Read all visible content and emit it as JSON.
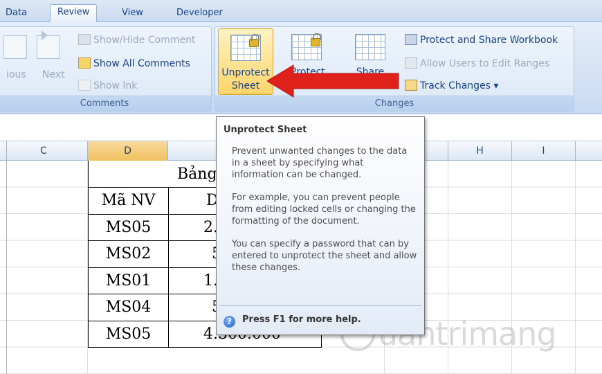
{
  "ribbon": {
    "tabs": [
      "Data",
      "Review",
      "View",
      "Developer"
    ],
    "active_tab": "Review",
    "comments_group": {
      "label": "Comments",
      "previous_label": "ious",
      "next_label": "Next",
      "show_hide": "Show/Hide Comment",
      "show_all": "Show All Comments",
      "show_ink": "Show Ink"
    },
    "changes_group": {
      "label": "Changes",
      "unprotect_sheet": [
        "Unprotect",
        "Sheet"
      ],
      "protect_workbook": [
        "Protect",
        "Workbook ▾"
      ],
      "share_workbook": [
        "Share",
        "Workbook"
      ],
      "protect_share": "Protect and Share Workbook",
      "allow_users": "Allow Users to Edit Ranges",
      "track_changes": "Track Changes ▾"
    }
  },
  "sheet": {
    "columns": [
      "C",
      "D",
      "",
      "",
      "",
      "H",
      "I"
    ],
    "selected_column": "D",
    "table": {
      "title": "Bảng",
      "header": [
        "Mã NV",
        "D"
      ],
      "rows": [
        [
          "MS05",
          "2."
        ],
        [
          "MS02",
          "5"
        ],
        [
          "MS01",
          "1."
        ],
        [
          "MS04",
          "5"
        ],
        [
          "MS05",
          "4.500.000"
        ]
      ]
    }
  },
  "tooltip": {
    "title": "Unprotect Sheet",
    "paragraphs": [
      "Prevent unwanted changes to the data in a sheet by specifying what information can be changed.",
      "For example, you can prevent people from editing locked cells or changing the formatting of the document.",
      "You can specify a password that can by entered to unprotect the sheet and allow these changes."
    ],
    "help": "Press F1 for more help."
  },
  "watermark": "uantrimang",
  "colors": {
    "ribbon_blue": "#15428b",
    "arrow_red": "#e0201b",
    "selected_header": "#f1c15f"
  }
}
